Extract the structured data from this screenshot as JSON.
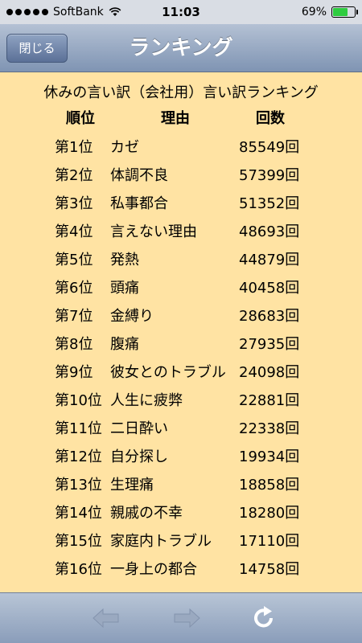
{
  "status_bar": {
    "carrier": "SoftBank",
    "time": "11:03",
    "battery_percent": "69%",
    "battery_level": 0.69
  },
  "nav": {
    "close_label": "閉じる",
    "title": "ランキング"
  },
  "content": {
    "heading": "休みの言い訳（会社用）言い訳ランキング",
    "columns": {
      "rank": "順位",
      "reason": "理由",
      "count": "回数"
    },
    "rows": [
      {
        "rank": "第1位",
        "reason": "カゼ",
        "count": "85549回"
      },
      {
        "rank": "第2位",
        "reason": "体調不良",
        "count": "57399回"
      },
      {
        "rank": "第3位",
        "reason": "私事都合",
        "count": "51352回"
      },
      {
        "rank": "第4位",
        "reason": "言えない理由",
        "count": "48693回"
      },
      {
        "rank": "第5位",
        "reason": "発熱",
        "count": "44879回"
      },
      {
        "rank": "第6位",
        "reason": "頭痛",
        "count": "40458回"
      },
      {
        "rank": "第7位",
        "reason": "金縛り",
        "count": "28683回"
      },
      {
        "rank": "第8位",
        "reason": "腹痛",
        "count": "27935回"
      },
      {
        "rank": "第9位",
        "reason": "彼女とのトラブル",
        "count": "24098回"
      },
      {
        "rank": "第10位",
        "reason": "人生に疲弊",
        "count": "22881回"
      },
      {
        "rank": "第11位",
        "reason": "二日酔い",
        "count": "22338回"
      },
      {
        "rank": "第12位",
        "reason": "自分探し",
        "count": "19934回"
      },
      {
        "rank": "第13位",
        "reason": "生理痛",
        "count": "18858回"
      },
      {
        "rank": "第14位",
        "reason": "親戚の不幸",
        "count": "18280回"
      },
      {
        "rank": "第15位",
        "reason": "家庭内トラブル",
        "count": "17110回"
      },
      {
        "rank": "第16位",
        "reason": "一身上の都合",
        "count": "14758回"
      }
    ]
  },
  "toolbar": {
    "back_icon": "arrow-left-icon",
    "forward_icon": "arrow-right-icon",
    "refresh_icon": "refresh-icon",
    "disabled_color": "#9aa9c0",
    "enabled_color": "#ffffff"
  }
}
